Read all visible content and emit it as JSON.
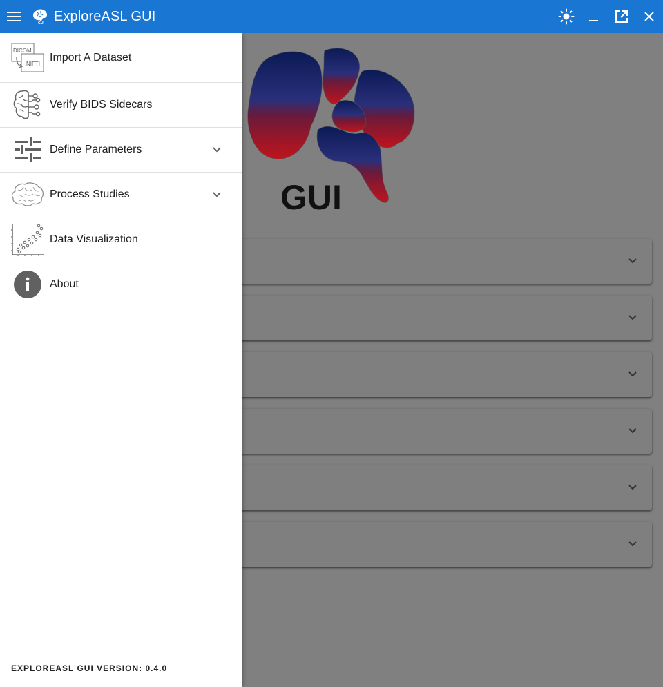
{
  "app": {
    "title": "ExploreASL GUI",
    "brand_icon": "brain-logo-icon"
  },
  "window_controls": {
    "theme": "sun-icon",
    "minimize": "minimize-icon",
    "popout": "open-in-new-icon",
    "close": "close-icon"
  },
  "logo": {
    "text": "GUI"
  },
  "drawer": {
    "items": [
      {
        "label": "Import A Dataset",
        "icon": "dicom-nifti-icon",
        "expandable": false
      },
      {
        "label": "Verify BIDS Sidecars",
        "icon": "brain-circuit-icon",
        "expandable": false
      },
      {
        "label": "Define Parameters",
        "icon": "tune-icon",
        "expandable": true
      },
      {
        "label": "Process Studies",
        "icon": "brain-icon",
        "expandable": true
      },
      {
        "label": "Data Visualization",
        "icon": "scatter-plot-icon",
        "expandable": false
      },
      {
        "label": "About",
        "icon": "info-icon",
        "expandable": false
      }
    ],
    "version": "EXPLOREASL GUI VERSION: 0.4.0"
  },
  "colors": {
    "appbar": "#1976d2",
    "overlay": "#808080",
    "logo_blue": "#1a2a7a",
    "logo_red": "#b3121c"
  }
}
